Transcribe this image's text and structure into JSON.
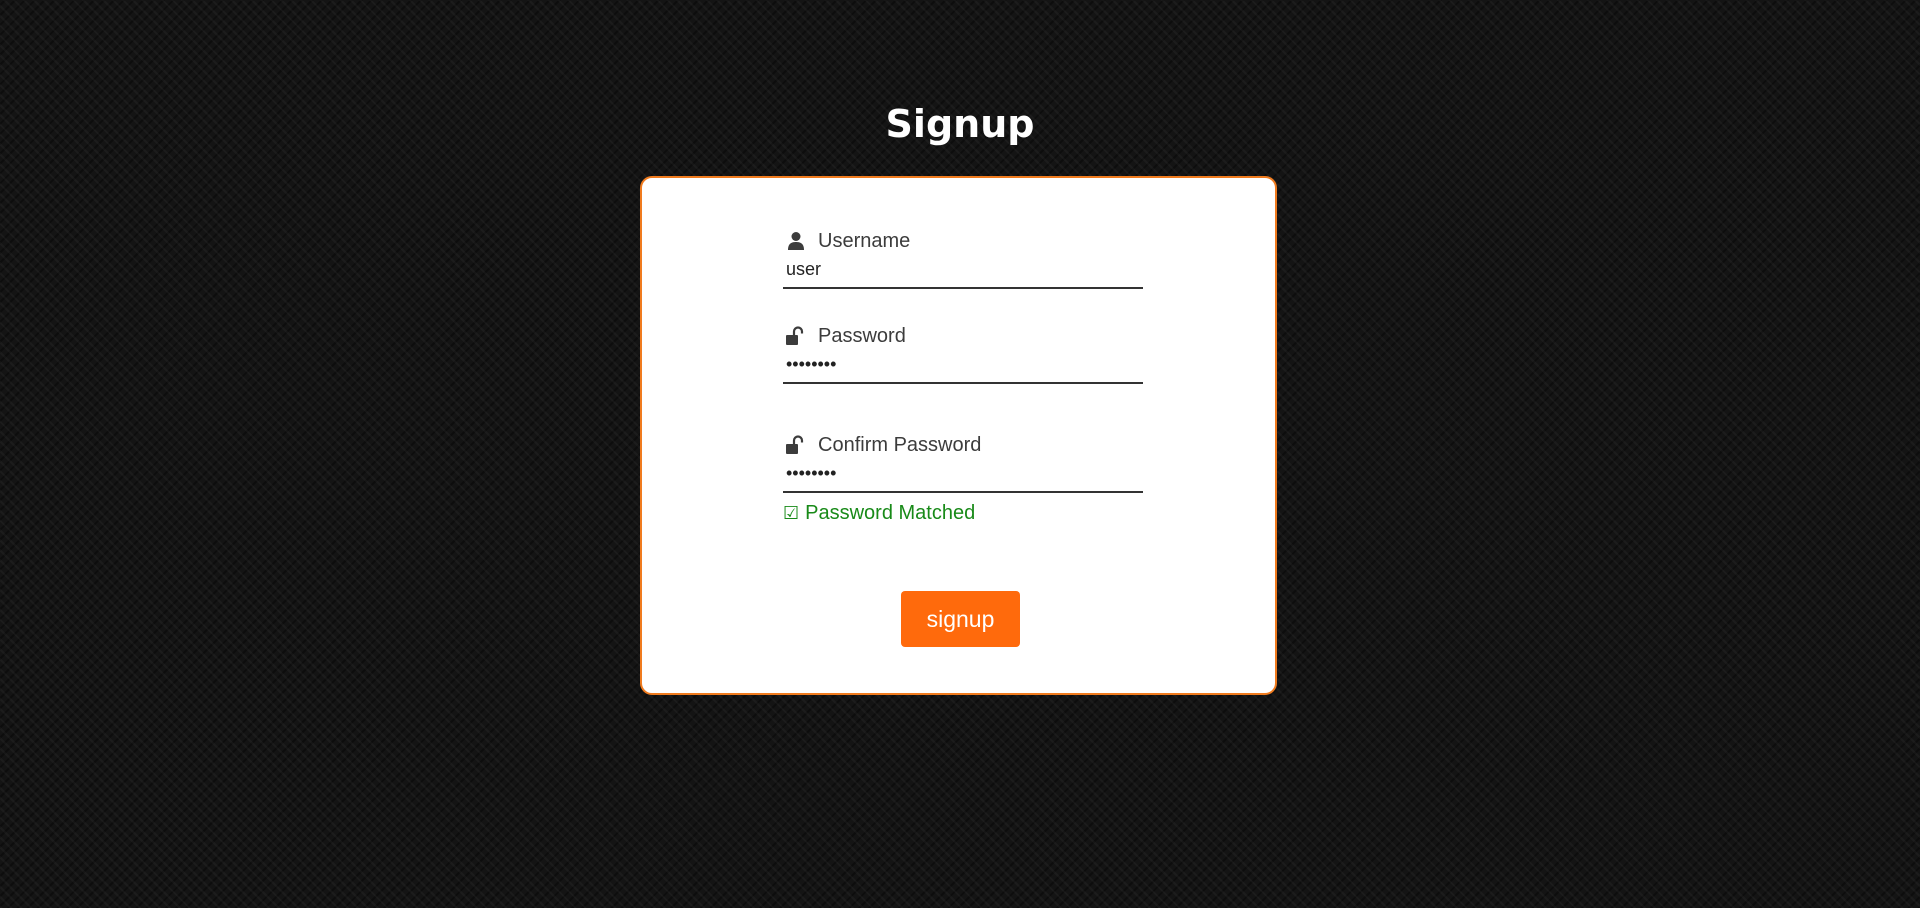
{
  "page": {
    "title": "Signup"
  },
  "form": {
    "username": {
      "label": "Username",
      "value": "user",
      "icon": "user-icon"
    },
    "password": {
      "label": "Password",
      "value": "••••••••",
      "icon": "unlock-icon"
    },
    "confirm_password": {
      "label": "Confirm Password",
      "value": "••••••••",
      "icon": "unlock-icon"
    },
    "match_message": {
      "icon": "☑",
      "text": "Password Matched"
    },
    "submit_label": "signup"
  },
  "colors": {
    "accent": "#ff6a0c",
    "card_border": "#f07b1e",
    "success": "#188a18",
    "background": "#141414"
  }
}
